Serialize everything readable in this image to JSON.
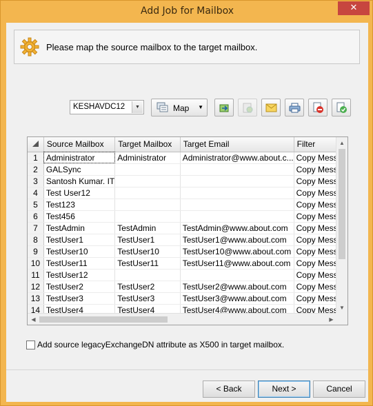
{
  "window": {
    "title": "Add Job for Mailbox",
    "close_label": "✕"
  },
  "banner": {
    "icon": "gear-icon",
    "message": "Please map the source mailbox to the target mailbox."
  },
  "toolbar": {
    "server_combo": "KESHAVDC12",
    "map_label": "Map",
    "icons": [
      "export-icon",
      "import-icon-disabled",
      "email-icon",
      "print-icon",
      "remove-icon",
      "verify-icon"
    ]
  },
  "grid": {
    "columns": [
      "Source Mailbox",
      "Target Mailbox",
      "Target Email",
      "Filter"
    ],
    "rows": [
      {
        "n": "1",
        "source": "Administrator",
        "target": "Administrator",
        "email": "Administrator@www.about.c...",
        "filter": "Copy Messag"
      },
      {
        "n": "2",
        "source": "GALSync",
        "target": "",
        "email": "",
        "filter": "Copy Messag"
      },
      {
        "n": "3",
        "source": "Santosh Kumar. IT",
        "target": "",
        "email": "",
        "filter": "Copy Messag"
      },
      {
        "n": "4",
        "source": "Test User12",
        "target": "",
        "email": "",
        "filter": "Copy Messag"
      },
      {
        "n": "5",
        "source": "Test123",
        "target": "",
        "email": "",
        "filter": "Copy Messag"
      },
      {
        "n": "6",
        "source": "Test456",
        "target": "",
        "email": "",
        "filter": "Copy Messag"
      },
      {
        "n": "7",
        "source": "TestAdmin",
        "target": "TestAdmin",
        "email": "TestAdmin@www.about.com",
        "filter": "Copy Messag"
      },
      {
        "n": "8",
        "source": "TestUser1",
        "target": "TestUser1",
        "email": "TestUser1@www.about.com",
        "filter": "Copy Messag"
      },
      {
        "n": "9",
        "source": "TestUser10",
        "target": "TestUser10",
        "email": "TestUser10@www.about.com",
        "filter": "Copy Messag"
      },
      {
        "n": "10",
        "source": "TestUser11",
        "target": "TestUser11",
        "email": "TestUser11@www.about.com",
        "filter": "Copy Messag"
      },
      {
        "n": "11",
        "source": "TestUser12",
        "target": "",
        "email": "",
        "filter": "Copy Messag"
      },
      {
        "n": "12",
        "source": "TestUser2",
        "target": "TestUser2",
        "email": "TestUser2@www.about.com",
        "filter": "Copy Messag"
      },
      {
        "n": "13",
        "source": "TestUser3",
        "target": "TestUser3",
        "email": "TestUser3@www.about.com",
        "filter": "Copy Messag"
      },
      {
        "n": "14",
        "source": "TestUser4",
        "target": "TestUser4",
        "email": "TestUser4@www.about.com",
        "filter": "Copy Messag"
      }
    ]
  },
  "options": {
    "x500_label": "Add source legacyExchangeDN attribute as X500 in target mailbox.",
    "x500_checked": false
  },
  "buttons": {
    "back": "< Back",
    "next": "Next >",
    "cancel": "Cancel"
  },
  "colors": {
    "title_bar": "#f3b64f",
    "close": "#c7463f"
  }
}
